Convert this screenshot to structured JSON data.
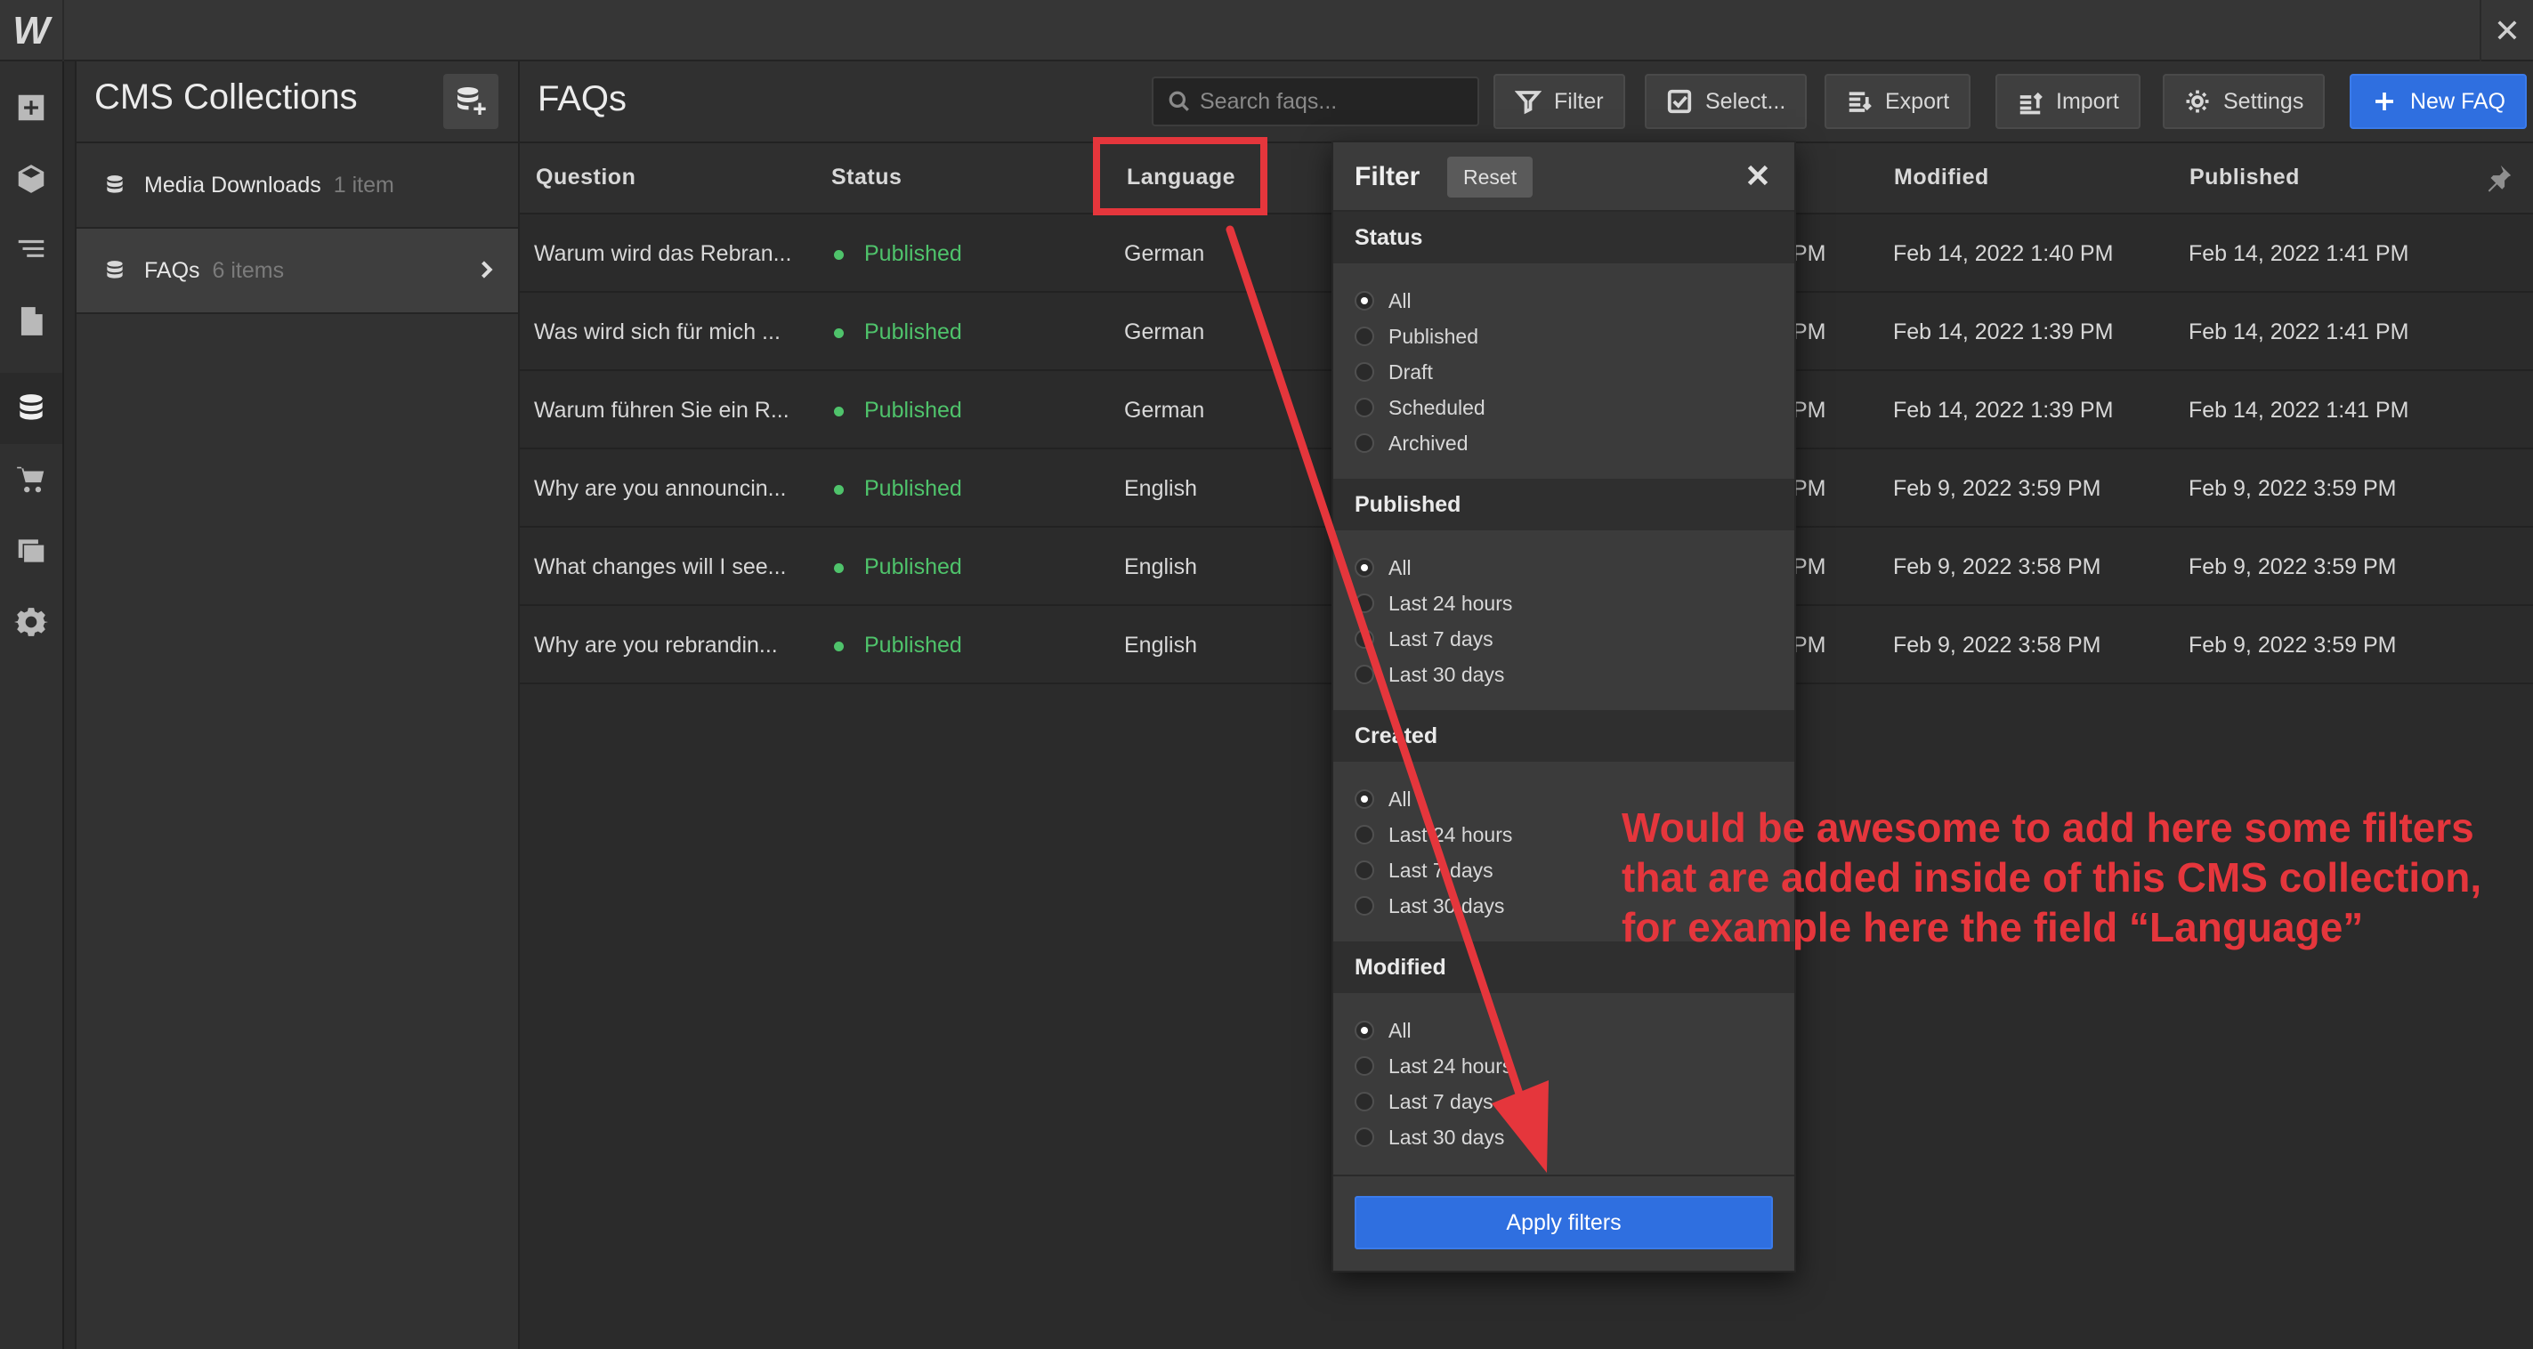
{
  "app": {
    "logo": "W",
    "close_icon": "close-icon"
  },
  "rail": {
    "items": [
      "add-icon",
      "box-icon",
      "navigator-icon",
      "pages-icon",
      "cms-icon",
      "ecommerce-icon",
      "assets-icon",
      "settings-icon"
    ],
    "active": "cms-icon"
  },
  "collections": {
    "title": "CMS Collections",
    "add_icon": "add-collection-icon",
    "items": [
      {
        "name": "Media Downloads",
        "count": "1 item"
      },
      {
        "name": "FAQs",
        "count": "6 items"
      }
    ]
  },
  "main": {
    "title": "FAQs",
    "search": {
      "placeholder": "Search faqs..."
    },
    "toolbar": {
      "filter_label": "Filter",
      "select_label": "Select...",
      "export_label": "Export",
      "import_label": "Import",
      "settings_label": "Settings",
      "new_label": "New FAQ"
    },
    "columns": {
      "question": "Question",
      "status": "Status",
      "language": "Language",
      "modified": "Modified",
      "published": "Published"
    },
    "rows": [
      {
        "question": "Warum wird das Rebran...",
        "status": "Published",
        "language": "German",
        "created_tail": "PM",
        "modified": "Feb 14, 2022 1:40 PM",
        "published": "Feb 14, 2022 1:41 PM"
      },
      {
        "question": "Was wird sich für mich ...",
        "status": "Published",
        "language": "German",
        "created_tail": "PM",
        "modified": "Feb 14, 2022 1:39 PM",
        "published": "Feb 14, 2022 1:41 PM"
      },
      {
        "question": "Warum führen Sie ein R...",
        "status": "Published",
        "language": "German",
        "created_tail": "PM",
        "modified": "Feb 14, 2022 1:39 PM",
        "published": "Feb 14, 2022 1:41 PM"
      },
      {
        "question": "Why are you announcin...",
        "status": "Published",
        "language": "English",
        "created_tail": "PM",
        "modified": "Feb 9, 2022 3:59 PM",
        "published": "Feb 9, 2022 3:59 PM"
      },
      {
        "question": "What changes will I see...",
        "status": "Published",
        "language": "English",
        "created_tail": "PM",
        "modified": "Feb 9, 2022 3:58 PM",
        "published": "Feb 9, 2022 3:59 PM"
      },
      {
        "question": "Why are you rebrandin...",
        "status": "Published",
        "language": "English",
        "created_tail": "PM",
        "modified": "Feb 9, 2022 3:58 PM",
        "published": "Feb 9, 2022 3:59 PM"
      }
    ]
  },
  "filter": {
    "title": "Filter",
    "reset_label": "Reset",
    "sections": [
      {
        "title": "Status",
        "options": [
          "All",
          "Published",
          "Draft",
          "Scheduled",
          "Archived"
        ],
        "selected": "All"
      },
      {
        "title": "Published",
        "options": [
          "All",
          "Last 24 hours",
          "Last 7 days",
          "Last 30 days"
        ],
        "selected": "All"
      },
      {
        "title": "Created",
        "options": [
          "All",
          "Last 24 hours",
          "Last 7 days",
          "Last 30 days"
        ],
        "selected": "All"
      },
      {
        "title": "Modified",
        "options": [
          "All",
          "Last 24 hours",
          "Last 7 days",
          "Last 30 days"
        ],
        "selected": "All"
      }
    ],
    "apply_label": "Apply filters"
  },
  "annotation": {
    "text": "Would be awesome to add here some filters that are added inside of this CMS collection, for example here the field “Language”",
    "color": "#e5363c"
  },
  "colors": {
    "accent": "#2f6fe0",
    "status_published": "#4fc36b",
    "annotation_red": "#e5363c"
  }
}
